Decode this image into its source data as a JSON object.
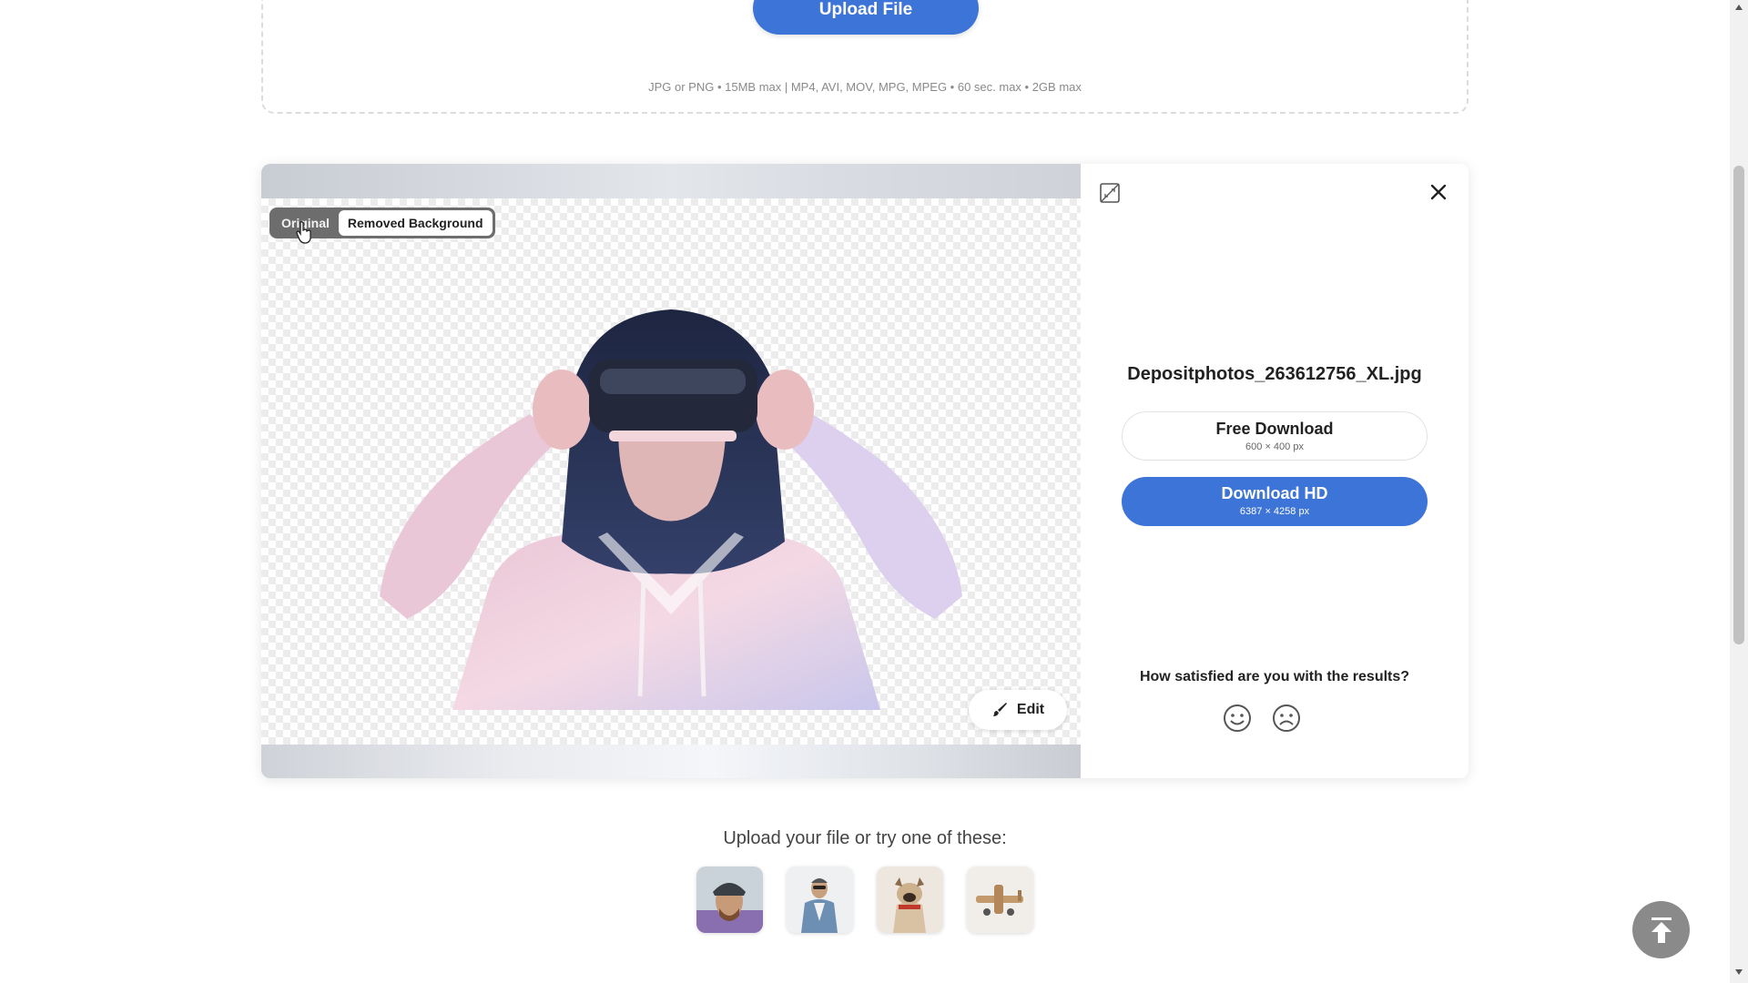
{
  "upload": {
    "button_label": "Upload File",
    "formats": "JPG or PNG • 15MB max | MP4, AVI, MOV, MPG, MPEG • 60 sec. max • 2GB max"
  },
  "preview": {
    "toggle": {
      "original": "Original",
      "removed": "Removed Background",
      "active": "removed"
    },
    "edit_label": "Edit"
  },
  "result": {
    "filename": "Depositphotos_263612756_XL.jpg",
    "free_download": {
      "label": "Free Download",
      "size": "600 × 400 px"
    },
    "download_hd": {
      "label": "Download HD",
      "size": "6387 × 4258 px"
    },
    "feedback_question": "How satisfied are you with the results?"
  },
  "samples": {
    "prompt": "Upload your file or try one of these:",
    "items": [
      "cyclist-with-helmet",
      "man-with-sunglasses",
      "dog-with-cap",
      "toy-airplane"
    ]
  },
  "icons": [
    "compare-icon",
    "close-icon",
    "brush-icon",
    "smile-icon",
    "frown-icon",
    "scroll-to-top-icon",
    "cursor-icon"
  ],
  "colors": {
    "accent": "#3d74d8",
    "toggle_bg": "#6d6d6d",
    "scroll_top_bg": "#8a8a8a"
  }
}
